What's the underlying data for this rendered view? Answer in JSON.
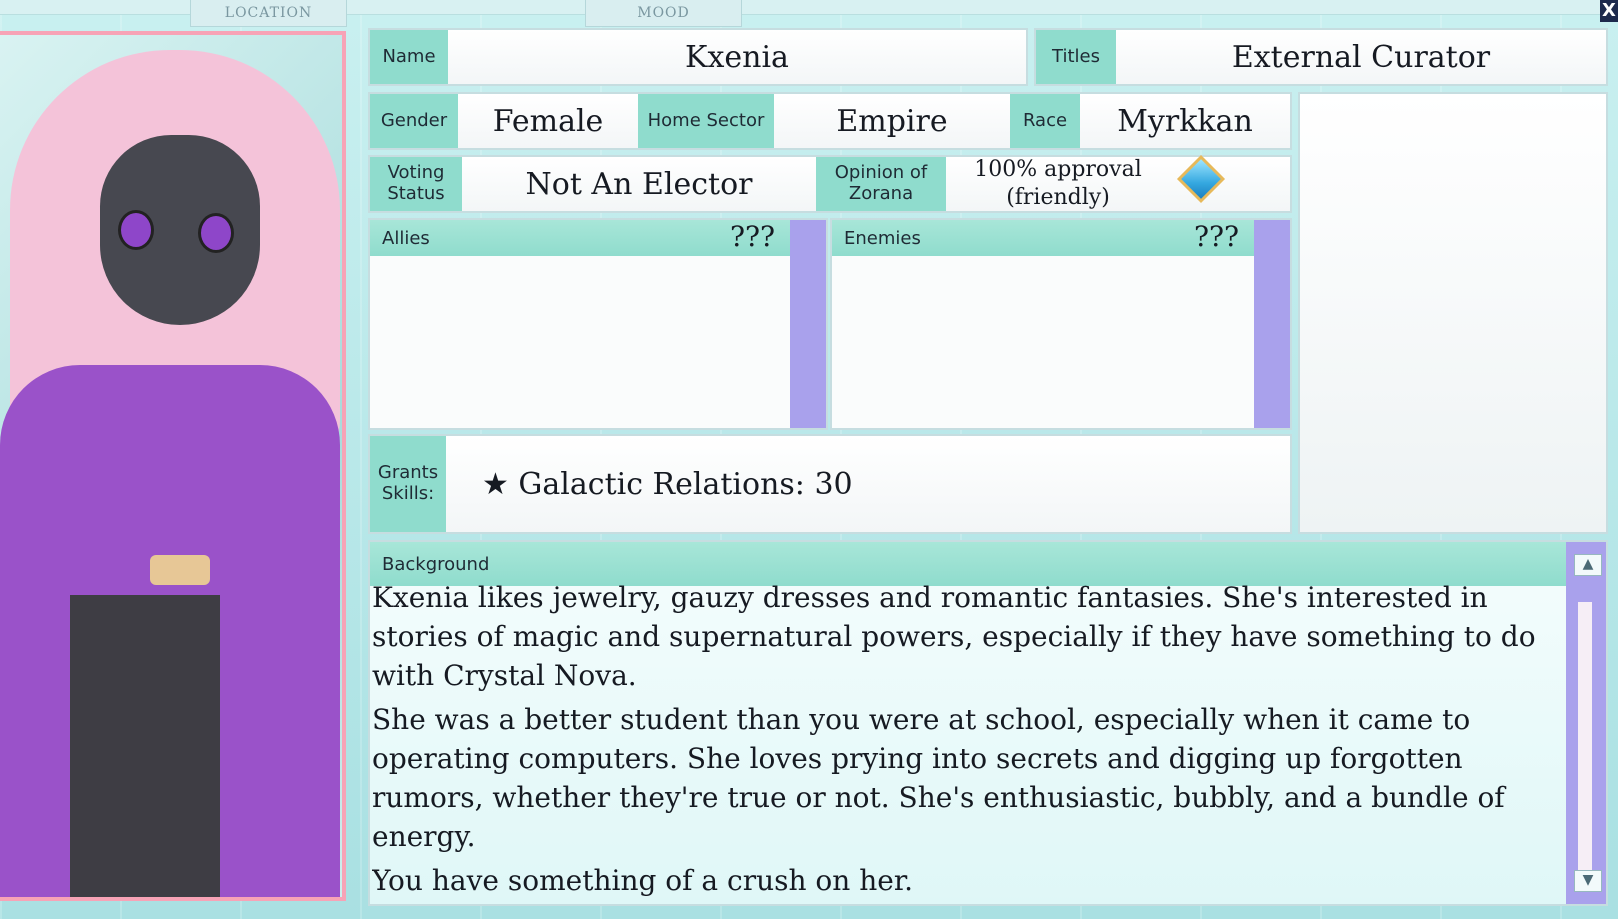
{
  "top_tabs": {
    "location": "LOCATION",
    "mood": "MOOD"
  },
  "close_label": "X",
  "character": {
    "name_label": "Name",
    "name": "Kxenia",
    "titles_label": "Titles",
    "titles": "External Curator",
    "gender_label": "Gender",
    "gender": "Female",
    "home_sector_label": "Home Sector",
    "home_sector": "Empire",
    "race_label": "Race",
    "race": "Myrkkan",
    "voting_label": "Voting Status",
    "voting": "Not An Elector",
    "opinion_label": "Opinion of Zorana",
    "opinion_line1": "100% approval",
    "opinion_line2": "(friendly)",
    "allies_label": "Allies",
    "allies_value": "???",
    "enemies_label": "Enemies",
    "enemies_value": "???",
    "grants_label": "Grants Skills:",
    "skill": "★ Galactic Relations: 30"
  },
  "background": {
    "label": "Background",
    "paragraphs": [
      "Kxenia likes jewelry, gauzy dresses and romantic fantasies. She's interested in stories of magic and supernatural powers, especially if they have something to do with Crystal Nova.",
      "She was a better student than you were at school, especially when it came to operating computers. She loves prying into secrets and digging up forgotten rumors, whether they're true or not. She's enthusiastic, bubbly, and a bundle of energy.",
      "You have something of a crush on her."
    ]
  },
  "colors": {
    "label_bg": "#8fdccd",
    "scrollbar": "#a9a1ec",
    "portrait_border": "#f7a3b6",
    "diamond": "#35a8e0"
  },
  "icons": {
    "approval": "diamond-icon",
    "scroll_up": "chevron-up-icon",
    "scroll_down": "chevron-down-icon"
  }
}
